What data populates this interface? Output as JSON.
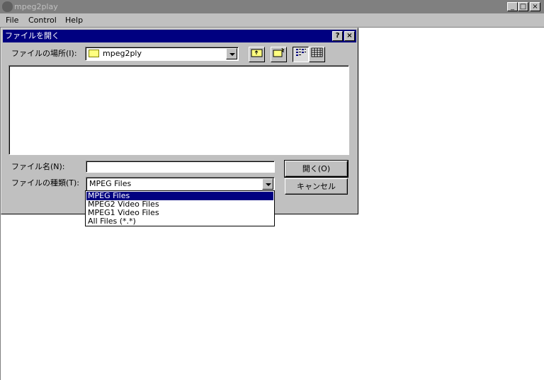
{
  "app": {
    "title": "mpeg2play",
    "window_buttons": {
      "minimize": "_",
      "maximize": "□",
      "close": "×"
    }
  },
  "menu": {
    "items": [
      {
        "label": "File"
      },
      {
        "label": "Control"
      },
      {
        "label": "Help"
      }
    ]
  },
  "dialog": {
    "title": "ファイルを開く",
    "help_button": "?",
    "close_button": "×",
    "look_in_label": "ファイルの場所(I):",
    "look_in_value": "mpeg2ply",
    "toolbar": {
      "up_folder_icon": "up-folder-icon",
      "new_folder_icon": "new-folder-icon",
      "list_view_icon": "list-view-icon",
      "details_view_icon": "details-view-icon"
    },
    "filename_label": "ファイル名(N):",
    "filename_value": "",
    "filetype_label": "ファイルの種類(T):",
    "filetype_value": "MPEG Files",
    "open_button": "開く(O)",
    "cancel_button": "キャンセル",
    "filetype_options": [
      "MPEG Files",
      "MPEG2 Video Files",
      "MPEG1 Video Files",
      "All Files (*.*)"
    ],
    "selected_option_index": 0
  },
  "colors": {
    "dialog_title_bg": "#000080",
    "inactive_title_bg": "#808080",
    "face": "#c0c0c0",
    "selection": "#000080"
  }
}
